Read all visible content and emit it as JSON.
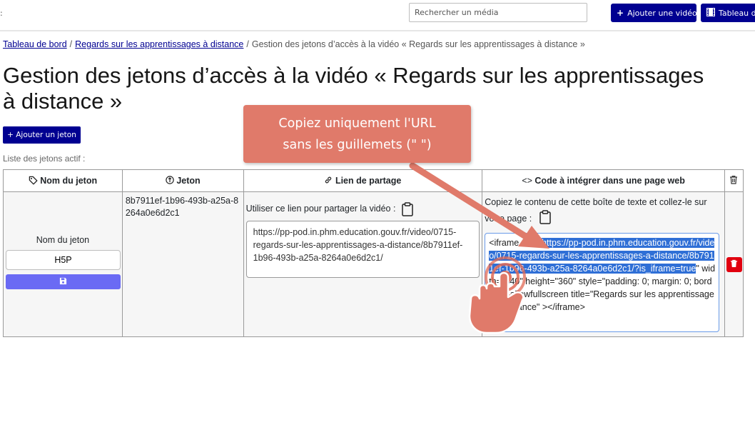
{
  "topbar": {
    "search_placeholder": "Rechercher un média",
    "add_video_label": "Ajouter une vidéo",
    "dashboard_label": "Tableau de bord"
  },
  "breadcrumb": {
    "home": "Tableau de bord",
    "video": "Regards sur les apprentissages à distance",
    "current": "Gestion des jetons d’accès à la vidéo « Regards sur les apprentissages à distance »"
  },
  "page_title": "Gestion des jetons d’accès à la vidéo « Regards sur les apprentissages à distance »",
  "add_token_label": "Ajouter un jeton",
  "list_label": "Liste des jetons actif :",
  "table": {
    "headers": {
      "name": "Nom du jeton",
      "token": "Jeton",
      "share_link": "Lien de partage",
      "embed_code": "Code à intégrer dans une page web"
    },
    "row": {
      "name_label": "Nom du jeton",
      "name_value": "H5P",
      "token": "8b7911ef-1b96-493b-a25a-8264a0e6d2c1",
      "share_label": "Utiliser ce lien pour partager la vidéo :",
      "share_url": "https://pp-pod.in.phm.education.gouv.fr/video/0715-regards-sur-les-apprentissages-a-distance/8b7911ef-1b96-493b-a25a-8264a0e6d2c1/",
      "embed_label": "Copiez le contenu de cette boîte de texte et collez-le sur votre page :",
      "embed_prefix": "<iframe src=\"",
      "embed_url": "https://pp-pod.in.phm.education.gouv.fr/video/0715-regards-sur-les-apprentissages-a-distance/8b7911ef-1b96-493b-a25a-8264a0e6d2c1/?is_iframe=true",
      "embed_suffix": "\" width=\"640\" height=\"360\" style=\"padding: 0; margin: 0; border:0\" allowfullscreen title=\"Regards sur les apprentissages à distance\" ></iframe>"
    }
  },
  "callout": {
    "line1": "Copiez uniquement l'URL",
    "line2": "sans les guillemets (\" \")"
  },
  "colors": {
    "primary": "#000091",
    "save_button": "#6a6af4",
    "delete_button": "#e1000f",
    "callout": "#e07a6a",
    "selection": "#2f6fd6"
  },
  "icons": [
    "plus-icon",
    "film-icon",
    "tag-icon",
    "token-icon",
    "link-icon",
    "code-icon",
    "trash-icon",
    "save-icon",
    "clipboard-icon",
    "tap-hand-icon"
  ]
}
